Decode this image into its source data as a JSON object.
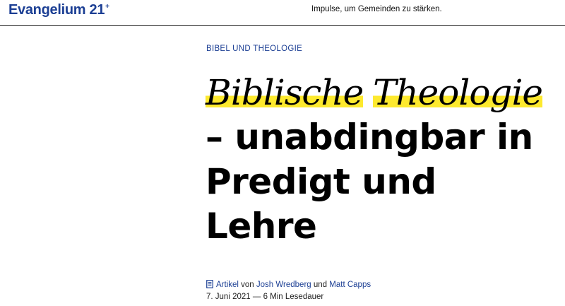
{
  "header": {
    "logo_text": "Evangelium 21",
    "logo_mark": "+",
    "tagline": "Impulse, um Gemeinden zu stärken."
  },
  "article": {
    "category": "BIBEL UND THEOLOGIE",
    "title_highlight_1": "Biblische",
    "title_highlight_2": "Theologie",
    "title_rest": " – unabdingbar in Predigt und Lehre",
    "type_label": "Artikel",
    "von": "von",
    "author_1": "Josh Wredberg",
    "und": "und",
    "author_2": "Matt Capps",
    "date": "7. Juni 2021",
    "separator": "—",
    "read_time": "6 Min Lesedauer"
  },
  "colors": {
    "brand_blue": "#1c3f94",
    "highlight_yellow": "#fde92e"
  },
  "icons": {
    "article_type": "document-icon"
  }
}
